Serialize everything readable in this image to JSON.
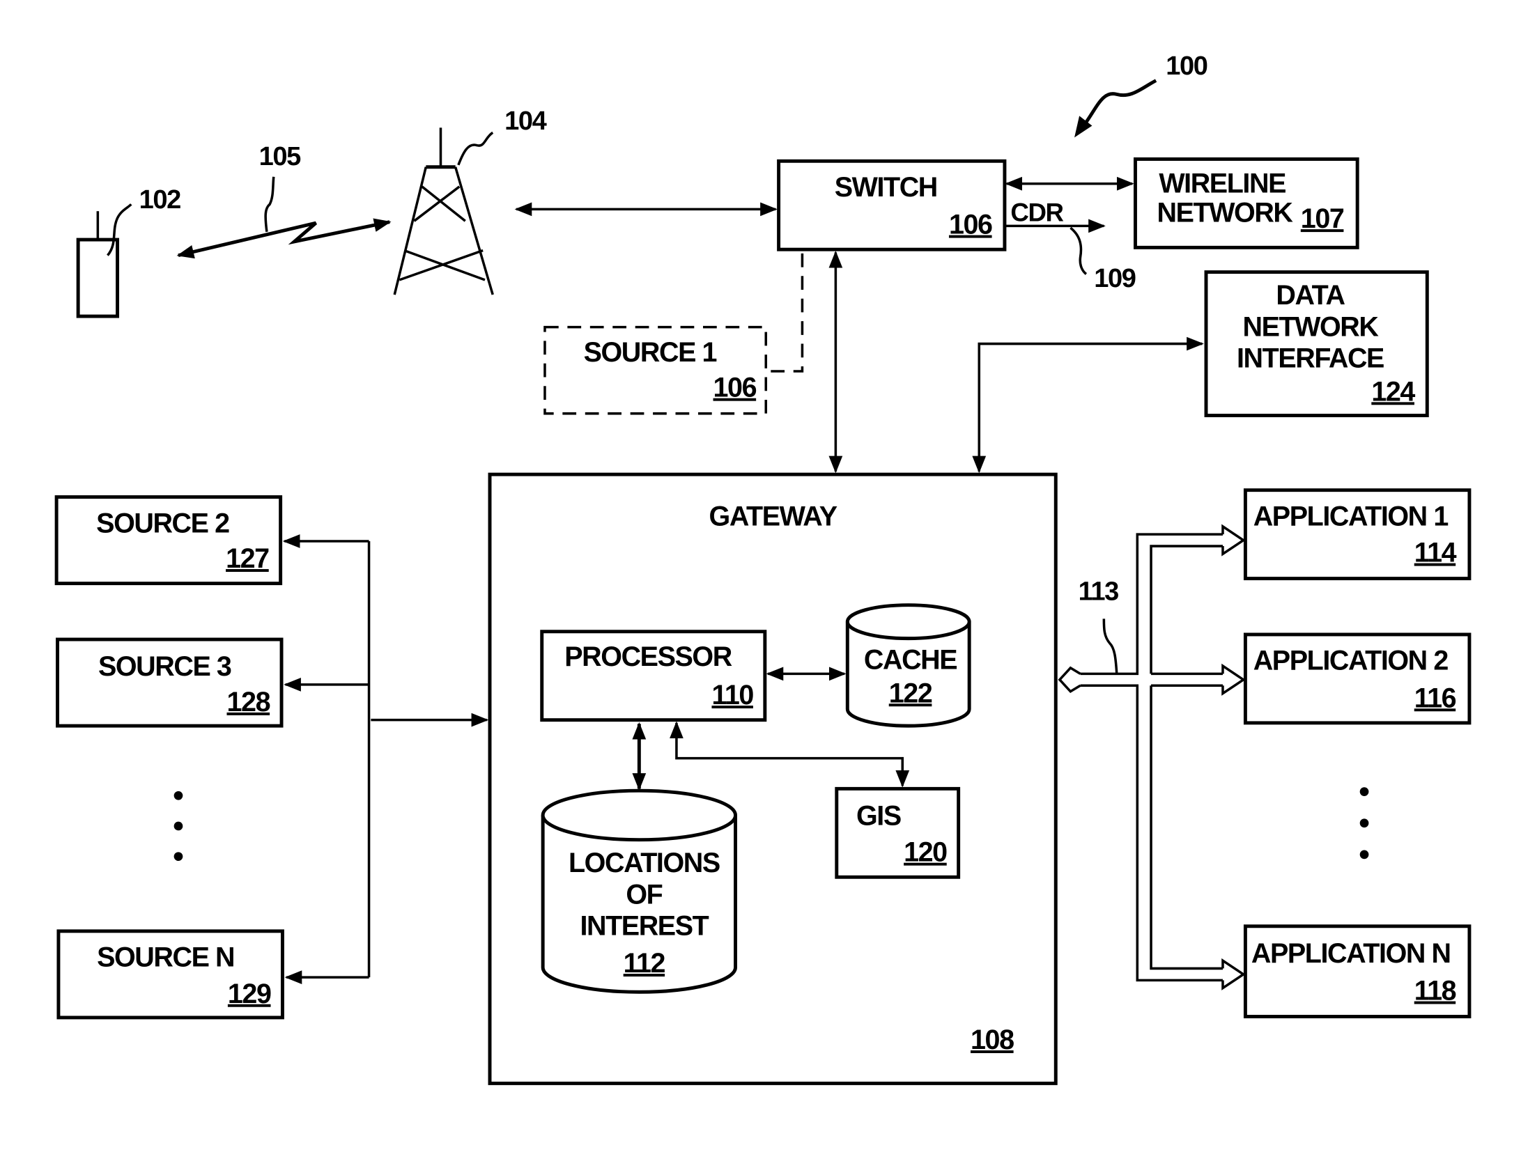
{
  "figure": {
    "ref": "100",
    "mobile_device": {
      "ref": "102"
    },
    "wireless_link": {
      "ref": "105"
    },
    "tower": {
      "ref": "104"
    },
    "switch": {
      "title": "SWITCH",
      "ref": "106"
    },
    "cdr": {
      "label": "CDR",
      "ref": "109"
    },
    "wireline": {
      "line1": "WIRELINE",
      "line2": "NETWORK",
      "ref": "107"
    },
    "data_network_interface": {
      "line1": "DATA",
      "line2": "NETWORK",
      "line3": "INTERFACE",
      "ref": "124"
    },
    "source1": {
      "title": "SOURCE 1",
      "ref": "106"
    },
    "sources": [
      {
        "title": "SOURCE 2",
        "ref": "127"
      },
      {
        "title": "SOURCE 3",
        "ref": "128"
      },
      {
        "title": "SOURCE N",
        "ref": "129"
      }
    ],
    "gateway": {
      "title": "GATEWAY",
      "ref": "108",
      "processor": {
        "title": "PROCESSOR",
        "ref": "110"
      },
      "cache": {
        "title": "CACHE",
        "ref": "122"
      },
      "gis": {
        "title": "GIS",
        "ref": "120"
      },
      "locations": {
        "line1": "LOCATIONS",
        "line2": "OF",
        "line3": "INTEREST",
        "ref": "112"
      }
    },
    "app_bus": {
      "ref": "113"
    },
    "applications": [
      {
        "title": "APPLICATION 1",
        "ref": "114"
      },
      {
        "title": "APPLICATION 2",
        "ref": "116"
      },
      {
        "title": "APPLICATION N",
        "ref": "118"
      }
    ]
  }
}
